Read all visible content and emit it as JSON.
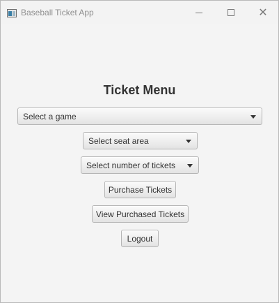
{
  "window": {
    "title": "Baseball Ticket App",
    "icon": "app-window-icon",
    "controls": {
      "minimize": "minimize-icon",
      "maximize": "maximize-icon",
      "close": "close-icon",
      "close_glyph": "✕"
    }
  },
  "menu": {
    "heading": "Ticket Menu",
    "game_select": {
      "selected": "Select a game"
    },
    "seat_select": {
      "selected": "Select seat area"
    },
    "ticket_count_select": {
      "selected": "Select number of tickets"
    },
    "buttons": {
      "purchase": "Purchase Tickets",
      "view_purchased": "View Purchased Tickets",
      "logout": "Logout"
    }
  }
}
